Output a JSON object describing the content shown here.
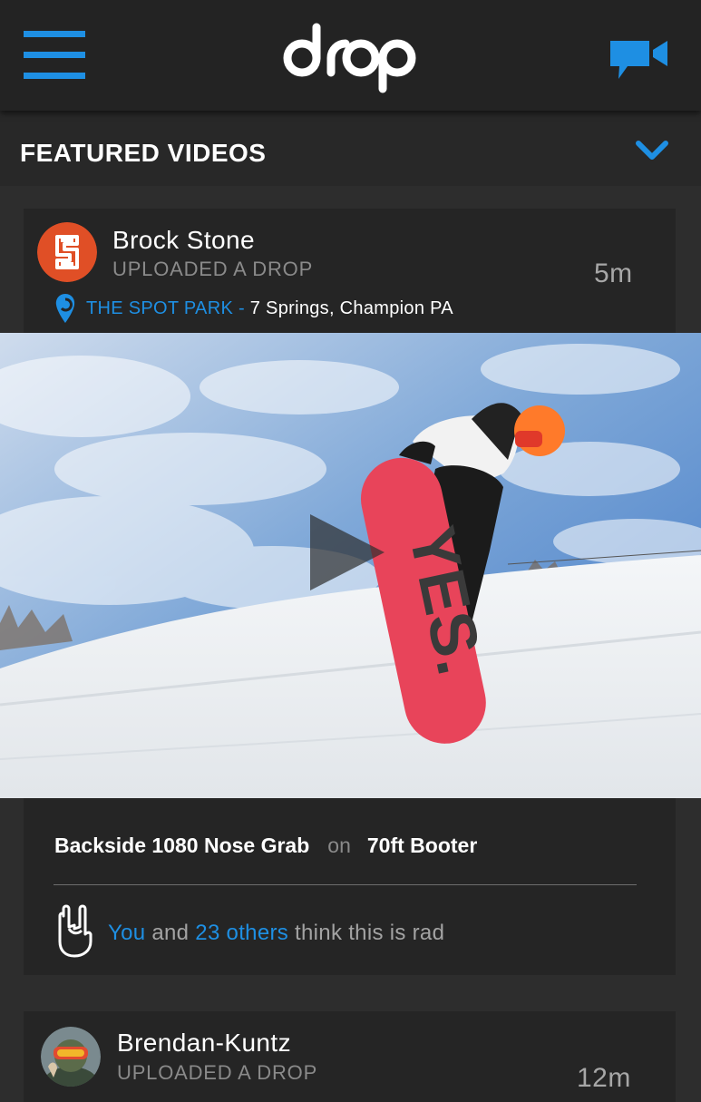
{
  "app": {
    "logo_text": "drop",
    "brand_color": "#1e8fe3",
    "menu_icon": "hamburger-menu-icon",
    "record_icon": "video-camera-icon"
  },
  "featured": {
    "title": "FEATURED VIDEOS",
    "toggle_icon": "chevron-down-icon"
  },
  "posts": [
    {
      "user": "Brock Stone",
      "action": "UPLOADED A DROP",
      "time": "5m",
      "location_park": "THE SPOT PARK",
      "location_separator": "-",
      "location_place": "7 Springs, Champion PA",
      "trick": "Backside 1080 Nose Grab",
      "connector": "on",
      "feature": "70ft Booter",
      "rad": {
        "you": "You",
        "and": "and",
        "others": "23 others",
        "tail": "think this is rad"
      }
    },
    {
      "user": "Brendan-Kuntz",
      "action": "UPLOADED A DROP",
      "time": "12m"
    }
  ]
}
